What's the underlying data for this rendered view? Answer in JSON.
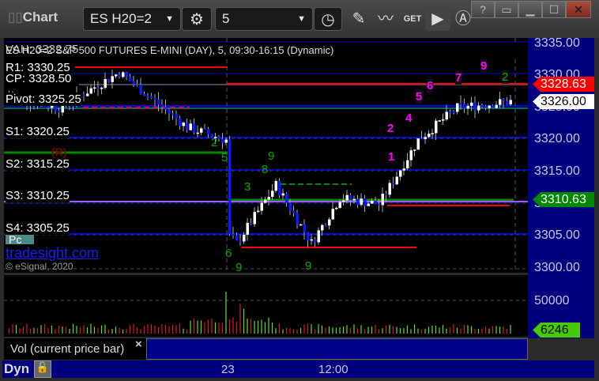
{
  "window": {
    "title": "Chart",
    "buttons": [
      "?",
      "restore",
      "minimize",
      "maximize",
      "close"
    ]
  },
  "toolbar": {
    "symbol": "ES H20=2",
    "interval": "5",
    "tools": [
      "gear-icon",
      "clock-icon",
      "pencil-icon",
      "study-icon",
      "get-icon",
      "play-icon",
      "alert-icon"
    ]
  },
  "chart": {
    "header": "ES H20=2 S&P 500 FUTURES E-MINI (DAY), 5, 09:30-16:15 (Dynamic)",
    "header_overlay": "VAH: 3332.75",
    "levels": [
      {
        "label": "R1: 3330.25"
      },
      {
        "label": "CP: 3328.50"
      },
      {
        "label": "Pivot: 3325.25"
      },
      {
        "label": "S1: 3320.25"
      },
      {
        "label": "S2: 3315.25"
      },
      {
        "label": "S3: 3310.25"
      },
      {
        "label": "S4: 3305.25"
      }
    ],
    "pc_label": "Pc",
    "marker": "(R)",
    "watermark": "tradesight.com",
    "copyright": "© eSignal, 2020",
    "price_axis": [
      "3335.00",
      "3330.00",
      "3325.00",
      "3320.00",
      "3315.00",
      "3310.00",
      "3305.00",
      "3300.00"
    ],
    "price_tags": {
      "last": "3328.63",
      "current": "3326.00",
      "level": "3310.63"
    },
    "counts_magenta": [
      "1",
      "2",
      "4",
      "5",
      "6",
      "7",
      "9"
    ],
    "counts_green": [
      "2",
      "9",
      "6",
      "9",
      "2",
      "5",
      "3",
      "8",
      "9"
    ],
    "price_path": [
      [
        0,
        3327
      ],
      [
        14,
        3325
      ],
      [
        31,
        3330.5
      ],
      [
        50,
        3322
      ],
      [
        61,
        3320
      ],
      [
        62,
        3305
      ],
      [
        64,
        3304
      ],
      [
        75,
        3313
      ],
      [
        85,
        3304
      ],
      [
        93,
        3311
      ],
      [
        104,
        3310
      ],
      [
        115,
        3320
      ],
      [
        126,
        3325
      ],
      [
        141,
        3326
      ]
    ],
    "colors": {
      "up": "#ffffff",
      "down": "#0a1cff",
      "vol_up": "#5ee02a",
      "vol_down": "#e01818",
      "axis": "#00007f"
    }
  },
  "volume": {
    "label": "Vol (current price bar)",
    "axis": "50000",
    "tag": "6246",
    "close": "×"
  },
  "time_axis": {
    "mode": "Dyn",
    "labels": [
      "23",
      "12:00"
    ]
  }
}
